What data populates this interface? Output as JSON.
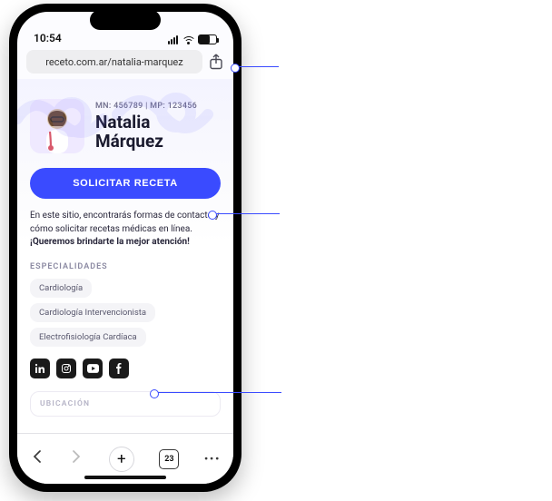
{
  "status": {
    "time": "10:54"
  },
  "browser": {
    "url": "receto.com.ar/natalia-marquez",
    "tab_count": "23"
  },
  "profile": {
    "ids_line": "MN: 456789 | MP: 123456",
    "name_first": "Natalia",
    "name_last": "Márquez",
    "cta_label": "SOLICITAR RECETA",
    "intro_plain": "En este sitio, encontrarás formas de contacto y cómo solicitar recetas médicas en línea. ",
    "intro_bold": "¡Queremos brindarte la mejor atención!",
    "section_specialities": "ESPECIALIDADES",
    "chips": [
      "Cardiología",
      "Cardiología Intervencionista",
      "Electrofisiología Cardíaca"
    ],
    "section_location": "UBICACIÓN"
  },
  "socials": [
    "linkedin",
    "instagram",
    "youtube",
    "facebook"
  ],
  "annotations": {
    "url_callout": "",
    "cta_callout": "",
    "socials_callout": ""
  },
  "colors": {
    "accent": "#3a4bff"
  }
}
